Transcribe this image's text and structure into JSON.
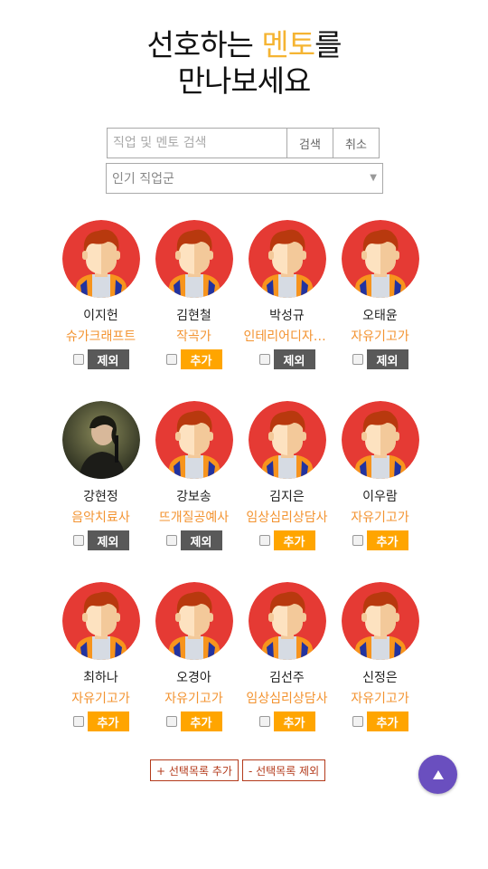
{
  "header": {
    "title_part1": "선호하는 ",
    "title_accent": "멘토",
    "title_part2": "를",
    "title_line2": "만나보세요"
  },
  "search": {
    "placeholder": "직업 및 멘토 검색",
    "search_label": "검색",
    "cancel_label": "취소"
  },
  "filter": {
    "selected": "인기 직업군"
  },
  "mentors": [
    {
      "name": "이지헌",
      "job": "슈가크래프트",
      "action": "제외",
      "photo": false
    },
    {
      "name": "김현철",
      "job": "작곡가",
      "action": "추가",
      "photo": false
    },
    {
      "name": "박성규",
      "job": "인테리어디자이너",
      "action": "제외",
      "photo": false
    },
    {
      "name": "오태윤",
      "job": "자유기고가",
      "action": "제외",
      "photo": false
    },
    {
      "name": "강현정",
      "job": "음악치료사",
      "action": "제외",
      "photo": true
    },
    {
      "name": "강보송",
      "job": "뜨개질공예사",
      "action": "제외",
      "photo": false
    },
    {
      "name": "김지은",
      "job": "임상심리상담사",
      "action": "추가",
      "photo": false
    },
    {
      "name": "이우람",
      "job": "자유기고가",
      "action": "추가",
      "photo": false
    },
    {
      "name": "최하나",
      "job": "자유기고가",
      "action": "추가",
      "photo": false
    },
    {
      "name": "오경아",
      "job": "자유기고가",
      "action": "추가",
      "photo": false
    },
    {
      "name": "김선주",
      "job": "임상심리상담사",
      "action": "추가",
      "photo": false
    },
    {
      "name": "신정은",
      "job": "자유기고가",
      "action": "추가",
      "photo": false
    }
  ],
  "bottom": {
    "add_selected": "+ 선택목록 추가",
    "remove_selected": "- 선택목록 제외"
  },
  "icons": {
    "scroll_top": "arrow-up-icon",
    "default_avatar": "person-avatar-icon"
  },
  "colors": {
    "accent": "#f5b432",
    "job": "#f39330",
    "add_button": "#ffa500",
    "exclude_button": "#595959",
    "outline_button": "#b33a1b",
    "scroll_top": "#6a4fbf",
    "avatar_bg": "#e53a34"
  }
}
